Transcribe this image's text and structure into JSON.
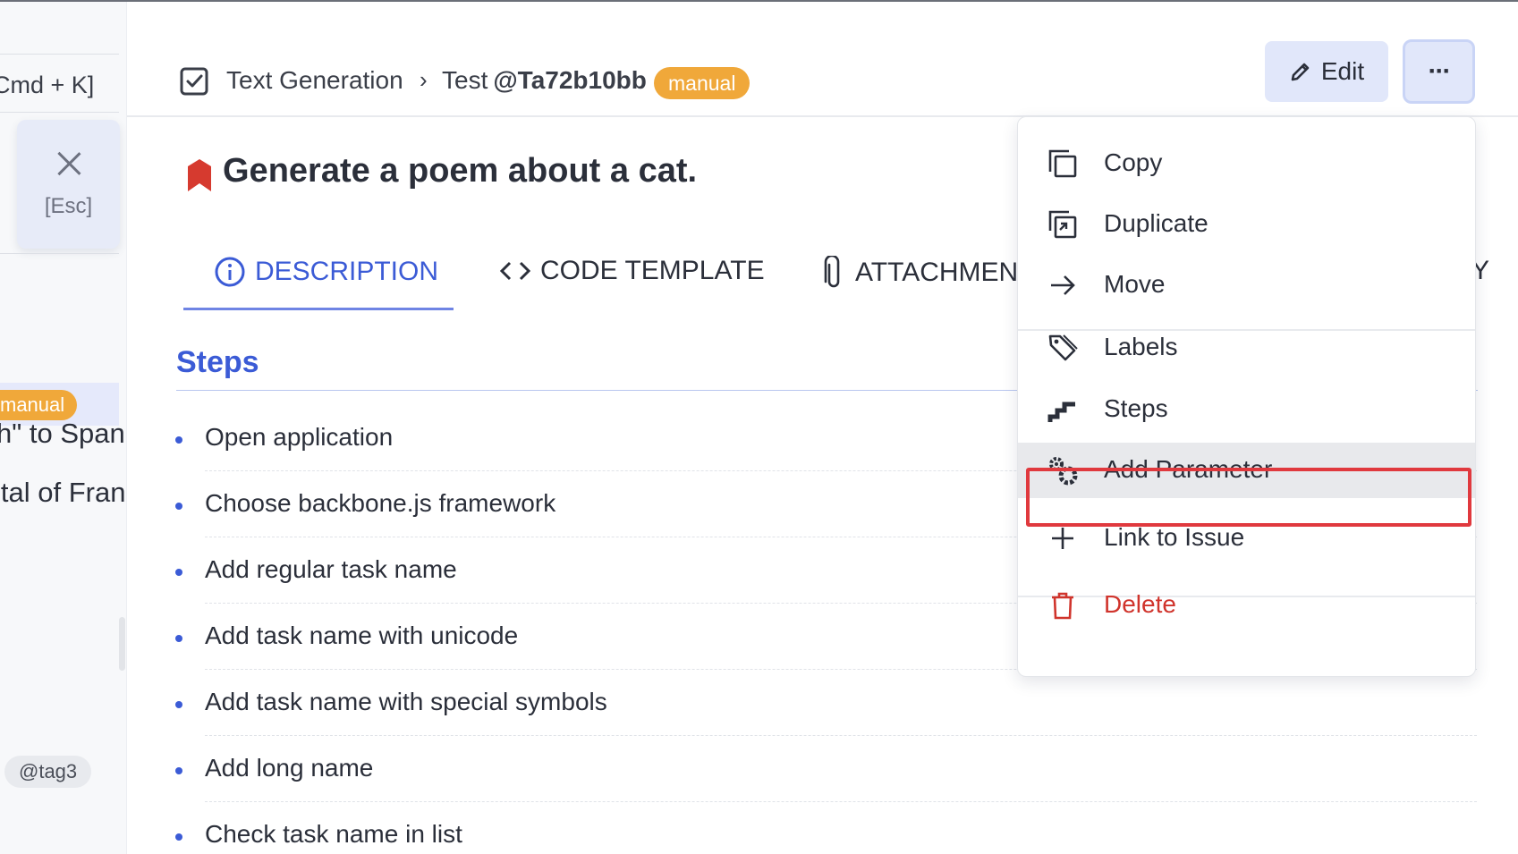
{
  "left_panel": {
    "shortcut": "Cmd + K]",
    "close_label": "[Esc]",
    "badge": "manual",
    "row1": "h\" to Spanish",
    "row2": "ital of France",
    "tag": "@tag3"
  },
  "header": {
    "breadcrumb_suite": "Text Generation",
    "breadcrumb_sep": "›",
    "breadcrumb_test_prefix": "Test",
    "breadcrumb_test_id": "@Ta72b10bb",
    "badge": "manual",
    "edit_label": "Edit",
    "more_label": "···"
  },
  "main": {
    "title": "Generate a poem about a cat.",
    "tabs": [
      {
        "label": "DESCRIPTION"
      },
      {
        "label": "CODE TEMPLATE"
      },
      {
        "label": "ATTACHMENTS"
      }
    ],
    "tab_cutoff": "Y",
    "steps_heading": "Steps",
    "steps": [
      "Open application",
      "Choose backbone.js framework",
      "Add regular task name",
      "Add task name with unicode",
      "Add task name with special symbols",
      "Add long name",
      "Check task name in list"
    ]
  },
  "menu": {
    "items": [
      {
        "label": "Copy",
        "icon": "copy-icon"
      },
      {
        "label": "Duplicate",
        "icon": "duplicate-icon"
      },
      {
        "label": "Move",
        "icon": "arrow-right-icon"
      },
      {
        "label": "Labels",
        "icon": "tags-icon"
      },
      {
        "label": "Steps",
        "icon": "stairs-icon"
      },
      {
        "label": "Add Parameter",
        "icon": "gears-icon"
      },
      {
        "label": "Link to Issue",
        "icon": "plus-icon"
      },
      {
        "label": "Delete",
        "icon": "trash-icon"
      }
    ]
  },
  "colors": {
    "accent": "#3b5bd6",
    "badge": "#f0a83a",
    "danger": "#d0342c",
    "highlight_outline": "#e0393e"
  }
}
